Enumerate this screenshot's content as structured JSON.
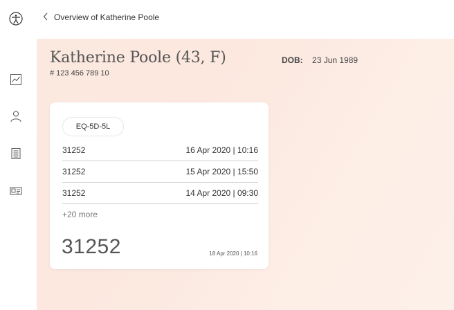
{
  "header": {
    "back_label": "Overview of Katherine Poole"
  },
  "patient": {
    "name": "Katherine Poole (43, F)",
    "id": "# 123 456 789 10",
    "dob_label": "DOB:",
    "dob_value": "23 Jun 1989"
  },
  "sidebar": {
    "items": [
      {
        "icon": "chart-icon"
      },
      {
        "icon": "person-icon"
      },
      {
        "icon": "document-icon"
      },
      {
        "icon": "id-card-icon"
      }
    ]
  },
  "card": {
    "chip_label": "EQ-5D-5L",
    "rows": [
      {
        "value": "31252",
        "date": "16 Apr 2020 | 10:16"
      },
      {
        "value": "31252",
        "date": "15 Apr 2020 | 15:50"
      },
      {
        "value": "31252",
        "date": "14 Apr 2020 | 09:30"
      }
    ],
    "more_label": "+20 more",
    "latest_value": "31252",
    "latest_date": "18 Apr 2020 | 10:16"
  },
  "colors": {
    "background_gradient_start": "#fbe9df",
    "background_gradient_end": "#fdf0e9",
    "card": "#ffffff"
  }
}
